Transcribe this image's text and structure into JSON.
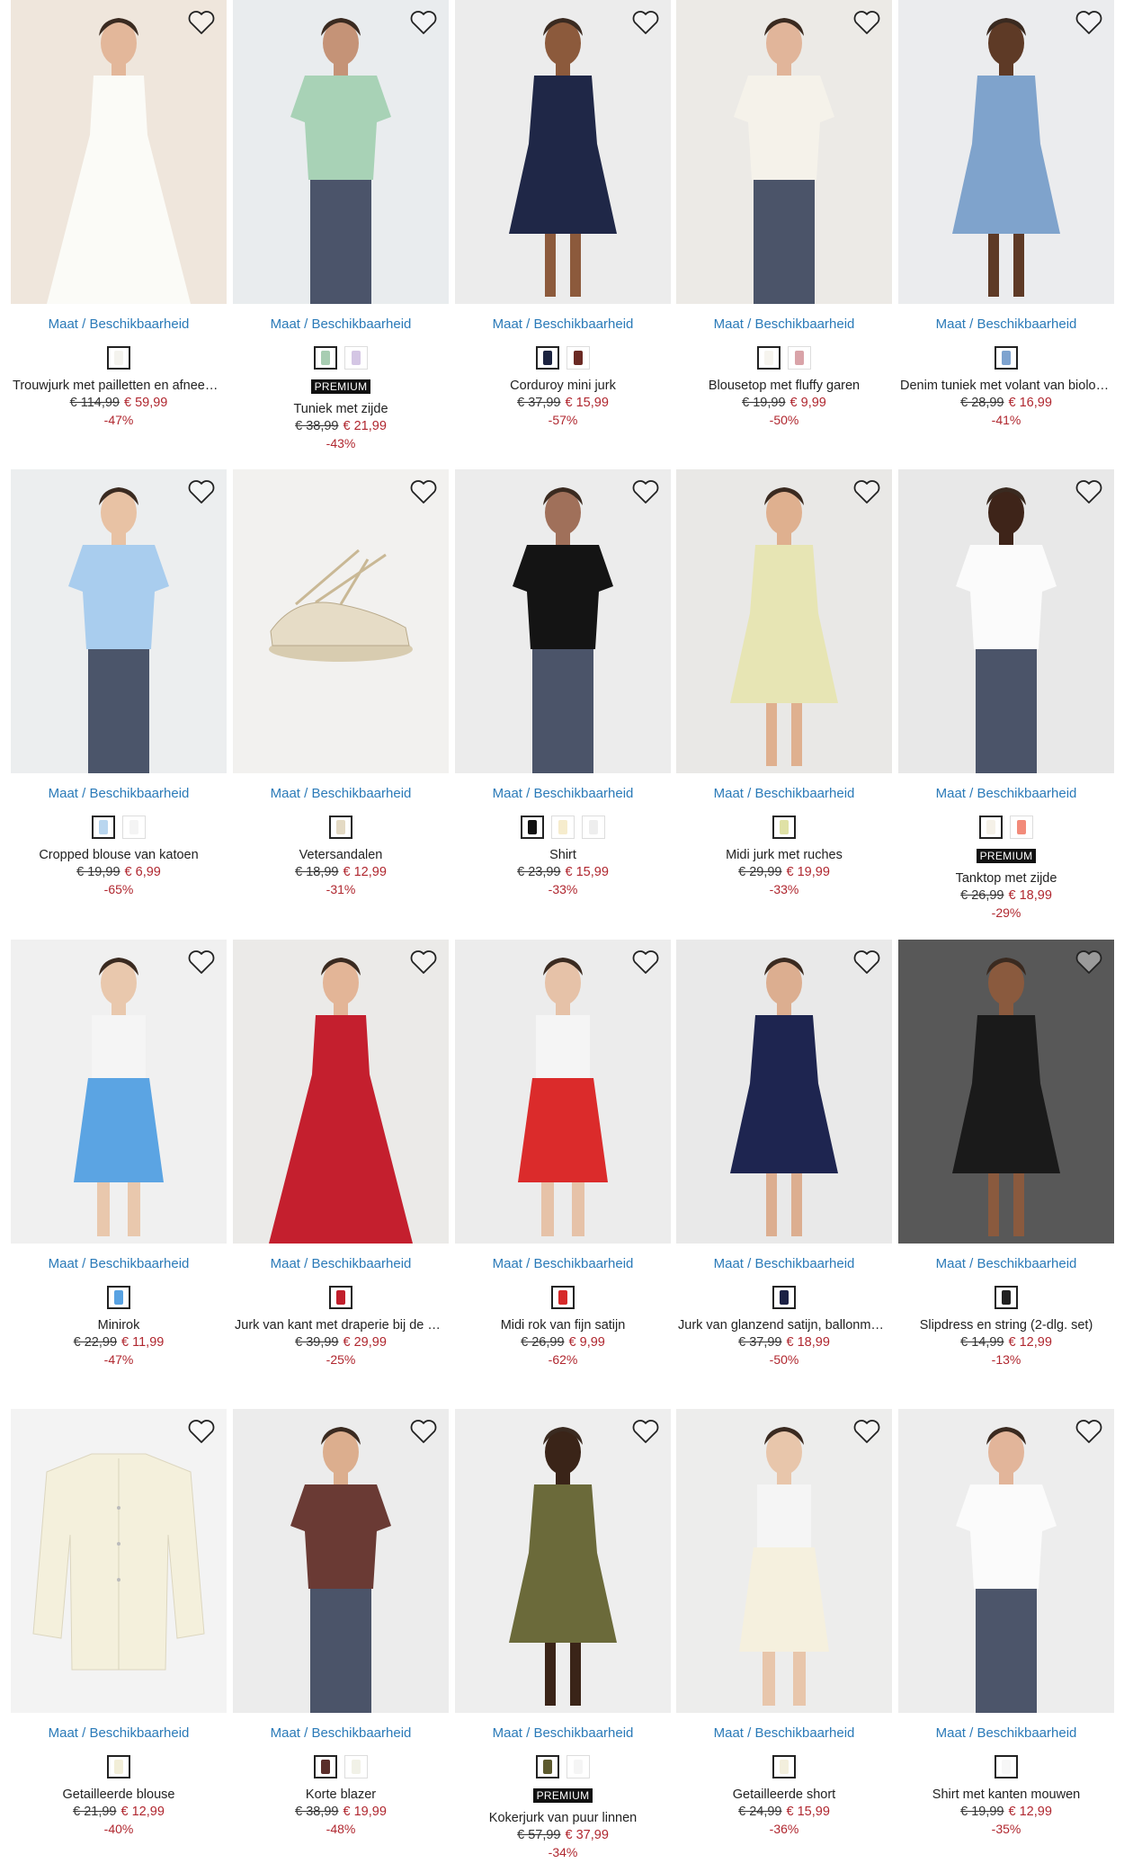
{
  "availability_label": "Maat / Beschikbaarheid",
  "favorite_icon": "heart-outline-icon",
  "products": [
    {
      "name": "Trouwjurk met pailletten en afneembare rok",
      "old_price": "€ 114,99",
      "new_price": "€ 59,99",
      "discount": "-47%",
      "badge": "",
      "swatches": [
        "#f4f3ee"
      ],
      "scene": "#efe6dc",
      "garment": "#fbfbf7",
      "type": "gown",
      "skin": "#e3b79a"
    },
    {
      "name": "Tuniek met zijde",
      "old_price": "€ 38,99",
      "new_price": "€ 21,99",
      "discount": "-43%",
      "badge": "PREMIUM",
      "swatches": [
        "#a8cdb2",
        "#d4c6e4"
      ],
      "scene": "#e9ecee",
      "garment": "#a8d2b6",
      "type": "top",
      "skin": "#c59377"
    },
    {
      "name": "Corduroy mini jurk",
      "old_price": "€ 37,99",
      "new_price": "€ 15,99",
      "discount": "-57%",
      "badge": "",
      "swatches": [
        "#1c2340",
        "#6b2a24"
      ],
      "scene": "#ececec",
      "garment": "#1f2747",
      "type": "dress",
      "skin": "#8c5a3c"
    },
    {
      "name": "Blousetop met fluffy garen",
      "old_price": "€ 19,99",
      "new_price": "€ 9,99",
      "discount": "-50%",
      "badge": "",
      "swatches": [
        "#f6f4ee",
        "#d9a3a8"
      ],
      "scene": "#eceae6",
      "garment": "#f5f2ea",
      "type": "top",
      "skin": "#e1b59a"
    },
    {
      "name": "Denim tuniek met volant van biologisch katoen",
      "old_price": "€ 28,99",
      "new_price": "€ 16,99",
      "discount": "-41%",
      "badge": "",
      "swatches": [
        "#7ea3cf"
      ],
      "scene": "#ebecee",
      "garment": "#7fa3cc",
      "type": "dress",
      "skin": "#5e3a26"
    },
    {
      "name": "Cropped blouse van katoen",
      "old_price": "€ 19,99",
      "new_price": "€ 6,99",
      "discount": "-65%",
      "badge": "",
      "swatches": [
        "#b9d6ef",
        "#f4f4f4"
      ],
      "scene": "#eceeef",
      "garment": "#a9cdee",
      "type": "top",
      "skin": "#e8c2a4"
    },
    {
      "name": "Vetersandalen",
      "old_price": "€ 18,99",
      "new_price": "€ 12,99",
      "discount": "-31%",
      "badge": "",
      "swatches": [
        "#e4dac4"
      ],
      "scene": "#f2f1ef",
      "garment": "#e6dcc6",
      "type": "shoe",
      "skin": "#e6dcc6"
    },
    {
      "name": "Shirt",
      "old_price": "€ 23,99",
      "new_price": "€ 15,99",
      "discount": "-33%",
      "badge": "",
      "swatches": [
        "#111111",
        "#f6eccd",
        "#eeeeee"
      ],
      "scene": "#ececec",
      "garment": "#141414",
      "type": "top",
      "skin": "#a0705a"
    },
    {
      "name": "Midi jurk met ruches",
      "old_price": "€ 29,99",
      "new_price": "€ 19,99",
      "discount": "-33%",
      "badge": "",
      "swatches": [
        "#dfe1a6"
      ],
      "scene": "#e9e8e6",
      "garment": "#e7e5b4",
      "type": "dress",
      "skin": "#dfb08f"
    },
    {
      "name": "Tanktop met zijde",
      "old_price": "€ 26,99",
      "new_price": "€ 18,99",
      "discount": "-29%",
      "badge": "PREMIUM",
      "swatches": [
        "#f5f1e8",
        "#f28b7a"
      ],
      "scene": "#e8e8e8",
      "garment": "#fbfbfb",
      "type": "top",
      "skin": "#3e2419"
    },
    {
      "name": "Minirok",
      "old_price": "€ 22,99",
      "new_price": "€ 11,99",
      "discount": "-47%",
      "badge": "",
      "swatches": [
        "#58a2e2"
      ],
      "scene": "#f0f0f0",
      "garment": "#5ba4e3",
      "type": "skirt",
      "skin": "#e9c8ad"
    },
    {
      "name": "Jurk van kant met draperie bij de mouwen",
      "old_price": "€ 39,99",
      "new_price": "€ 29,99",
      "discount": "-25%",
      "badge": "",
      "swatches": [
        "#c11f2c"
      ],
      "scene": "#ebeae8",
      "garment": "#c41f2e",
      "type": "gown",
      "skin": "#e3b597"
    },
    {
      "name": "Midi rok van fijn satijn",
      "old_price": "€ 26,99",
      "new_price": "€ 9,99",
      "discount": "-62%",
      "badge": "",
      "swatches": [
        "#d62a2a"
      ],
      "scene": "#ececec",
      "garment": "#db2b2b",
      "type": "skirt",
      "skin": "#e6c2a8"
    },
    {
      "name": "Jurk van glanzend satijn, ballonmodel",
      "old_price": "€ 37,99",
      "new_price": "€ 18,99",
      "discount": "-50%",
      "badge": "",
      "swatches": [
        "#1b2145"
      ],
      "scene": "#e9e9e9",
      "garment": "#1e2550",
      "type": "dress",
      "skin": "#dcae90"
    },
    {
      "name": "Slipdress en string (2-dlg. set)",
      "old_price": "€ 14,99",
      "new_price": "€ 12,99",
      "discount": "-13%",
      "badge": "",
      "swatches": [
        "#222222"
      ],
      "scene": "#585858",
      "garment": "#1a1a1a",
      "type": "dress",
      "skin": "#8a5a3e"
    },
    {
      "name": "Getailleerde blouse",
      "old_price": "€ 21,99",
      "new_price": "€ 12,99",
      "discount": "-40%",
      "badge": "",
      "swatches": [
        "#f2eed8"
      ],
      "scene": "#f3f3f3",
      "garment": "#f4f0dc",
      "type": "flat",
      "skin": "#f4f0dc"
    },
    {
      "name": "Korte blazer",
      "old_price": "€ 38,99",
      "new_price": "€ 19,99",
      "discount": "-48%",
      "badge": "",
      "swatches": [
        "#5a2e2a",
        "#f1f1e7"
      ],
      "scene": "#ececec",
      "garment": "#6a3a34",
      "type": "top",
      "skin": "#dcae8e"
    },
    {
      "name": "Kokerjurk van puur linnen",
      "old_price": "€ 57,99",
      "new_price": "€ 37,99",
      "discount": "-34%",
      "badge": "PREMIUM",
      "swatches": [
        "#5d5a2e",
        "#f5f5f5"
      ],
      "scene": "#eeeeee",
      "garment": "#6b6a3a",
      "type": "dress",
      "skin": "#3a2418"
    },
    {
      "name": "Getailleerde short",
      "old_price": "€ 24,99",
      "new_price": "€ 15,99",
      "discount": "-36%",
      "badge": "",
      "swatches": [
        "#f3efdd"
      ],
      "scene": "#ededec",
      "garment": "#f5f0de",
      "type": "skirt",
      "skin": "#e8c6ab"
    },
    {
      "name": "Shirt met kanten mouwen",
      "old_price": "€ 19,99",
      "new_price": "€ 12,99",
      "discount": "-35%",
      "badge": "",
      "swatches": [
        "#f7f7f7"
      ],
      "scene": "#ededed",
      "garment": "#fbfbfb",
      "type": "top",
      "skin": "#e2b59a"
    }
  ]
}
